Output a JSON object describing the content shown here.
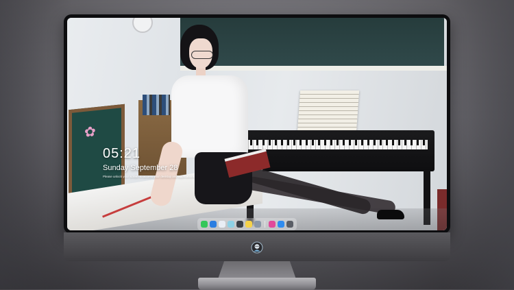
{
  "lock_screen": {
    "time": "05:21",
    "date": "Sunday September 28",
    "note": "Please unlock your screen to access your desktop and applications"
  },
  "dock": {
    "apps": [
      {
        "name": "messages-app-icon",
        "color": "#34c759"
      },
      {
        "name": "finder-app-icon",
        "color": "#2a7de1"
      },
      {
        "name": "safari-app-icon",
        "color": "#e9eef5"
      },
      {
        "name": "notes-app-icon",
        "color": "#8ed1e6"
      },
      {
        "name": "claquette-app-icon",
        "color": "#3a3f47"
      },
      {
        "name": "stickies-app-icon",
        "color": "#f5d24a"
      },
      {
        "name": "preview-app-icon",
        "color": "#8a97a8"
      },
      {
        "name": "itunes-app-icon",
        "color": "#e14a9b"
      },
      {
        "name": "app-store-icon",
        "color": "#2f8cf0"
      },
      {
        "name": "screenshot-app-icon",
        "color": "#5a5e66"
      }
    ]
  },
  "colors": {
    "bezel": "#0d0d0f",
    "chin": "#4a494d",
    "text": "#ffffff"
  }
}
